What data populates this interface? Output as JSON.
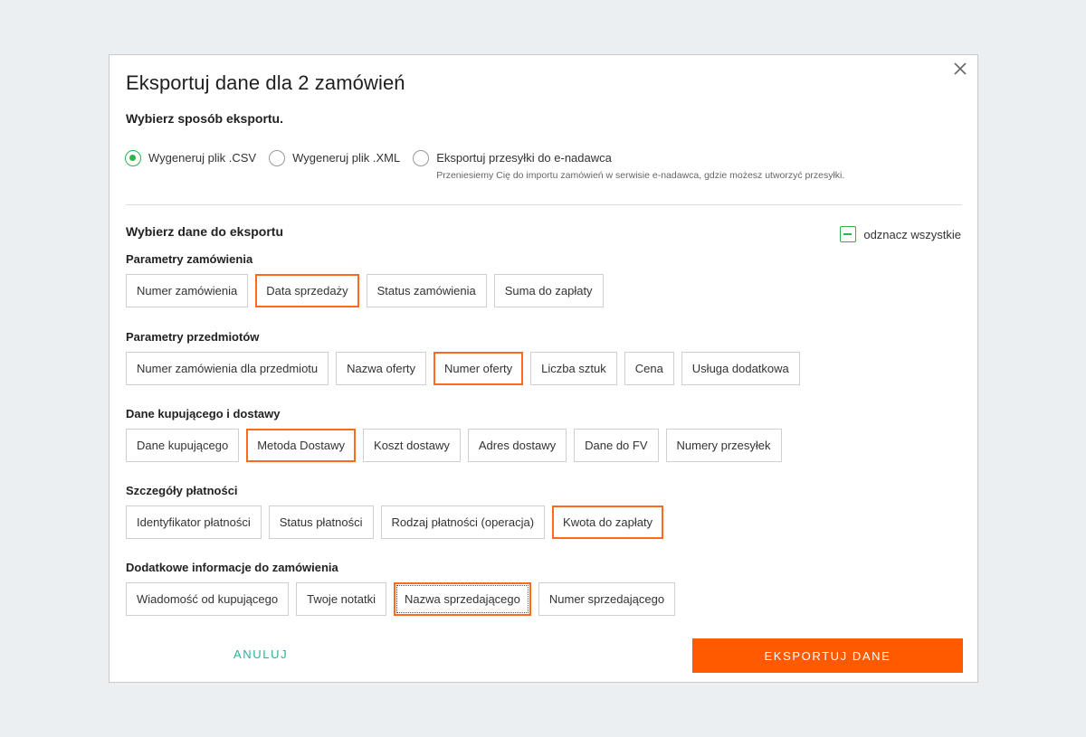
{
  "dialog": {
    "title": "Eksportuj dane dla 2 zamówień",
    "export_method_title": "Wybierz sposób eksportu.",
    "export_methods": [
      {
        "label": "Wygeneruj plik .CSV",
        "checked": true,
        "hint": ""
      },
      {
        "label": "Wygeneruj plik .XML",
        "checked": false,
        "hint": ""
      },
      {
        "label": "Eksportuj przesyłki do e-nadawca",
        "checked": false,
        "hint": "Przeniesiemy Cię do importu zamówień w serwisie e-nadawca, gdzie możesz utworzyć przesyłki."
      }
    ],
    "data_title": "Wybierz dane do eksportu",
    "deselect_all_label": "odznacz wszystkie",
    "groups": [
      {
        "title": "Parametry zamówienia",
        "fields": [
          {
            "label": "Numer zamówienia",
            "state": "default"
          },
          {
            "label": "Data sprzedaży",
            "state": "selected"
          },
          {
            "label": "Status zamówienia",
            "state": "default"
          },
          {
            "label": "Suma do zapłaty",
            "state": "default"
          }
        ]
      },
      {
        "title": "Parametry przedmiotów",
        "fields": [
          {
            "label": "Numer zamówienia dla przedmiotu",
            "state": "default"
          },
          {
            "label": "Nazwa oferty",
            "state": "default"
          },
          {
            "label": "Numer oferty",
            "state": "selected"
          },
          {
            "label": "Liczba sztuk",
            "state": "default"
          },
          {
            "label": "Cena",
            "state": "default"
          },
          {
            "label": "Usługa dodatkowa",
            "state": "default"
          }
        ]
      },
      {
        "title": "Dane kupującego i dostawy",
        "fields": [
          {
            "label": "Dane kupującego",
            "state": "default"
          },
          {
            "label": "Metoda Dostawy",
            "state": "selected"
          },
          {
            "label": "Koszt dostawy",
            "state": "default"
          },
          {
            "label": "Adres dostawy",
            "state": "default"
          },
          {
            "label": "Dane do FV",
            "state": "default"
          },
          {
            "label": "Numery przesyłek",
            "state": "default"
          }
        ]
      },
      {
        "title": "Szczegóły płatności",
        "fields": [
          {
            "label": "Identyfikator płatności",
            "state": "default"
          },
          {
            "label": "Status płatności",
            "state": "default"
          },
          {
            "label": "Rodzaj płatności (operacja)",
            "state": "default"
          },
          {
            "label": "Kwota do zapłaty",
            "state": "selected"
          }
        ]
      },
      {
        "title": "Dodatkowe informacje do zamówienia",
        "fields": [
          {
            "label": "Wiadomość od kupującego",
            "state": "default"
          },
          {
            "label": "Twoje notatki",
            "state": "default"
          },
          {
            "label": "Nazwa sprzedającego",
            "state": "focused"
          },
          {
            "label": "Numer sprzedającego",
            "state": "default"
          }
        ]
      }
    ],
    "cancel_label": "ANULUJ",
    "export_label": "EKSPORTUJ DANE",
    "colors": {
      "accent_orange": "#ff5a00",
      "selected_border": "#ff6a1a",
      "radio_green": "#2eb34a",
      "cancel_teal": "#27b09c"
    },
    "icons": {
      "close": "close-icon",
      "deselect_all": "minus-checkbox-icon"
    }
  }
}
